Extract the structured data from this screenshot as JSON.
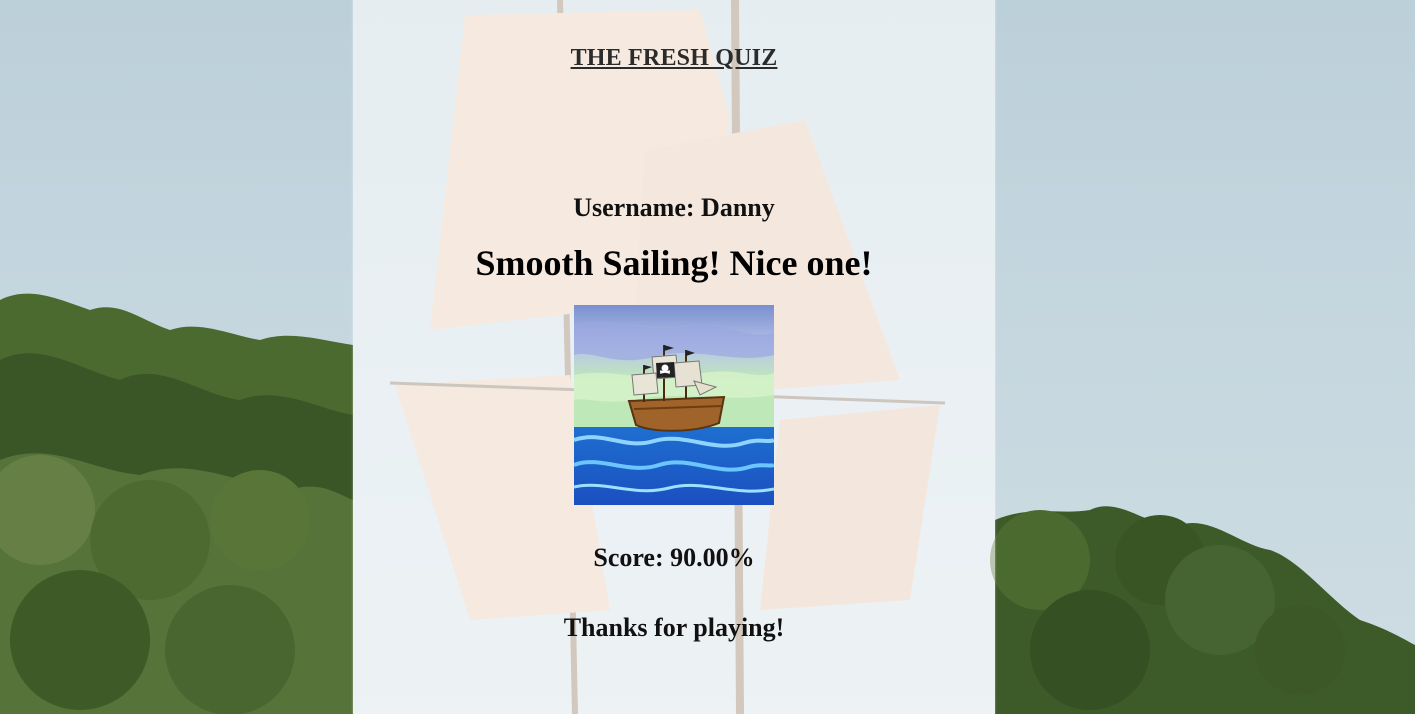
{
  "quiz": {
    "title": "THE FRESH QUIZ",
    "username_label": "Username: Danny",
    "result_message": "Smooth Sailing! Nice one!",
    "score_label": "Score: 90.00%",
    "closing_message": "Thanks for playing!"
  },
  "images": {
    "result_image": "pirate-ship-illustration",
    "background": "tall-ship-sails-photo"
  },
  "colors": {
    "sky": "#c2d5de",
    "trees": "#3f5a2a",
    "panel_overlay": "#ffffff",
    "text": "#111111"
  }
}
